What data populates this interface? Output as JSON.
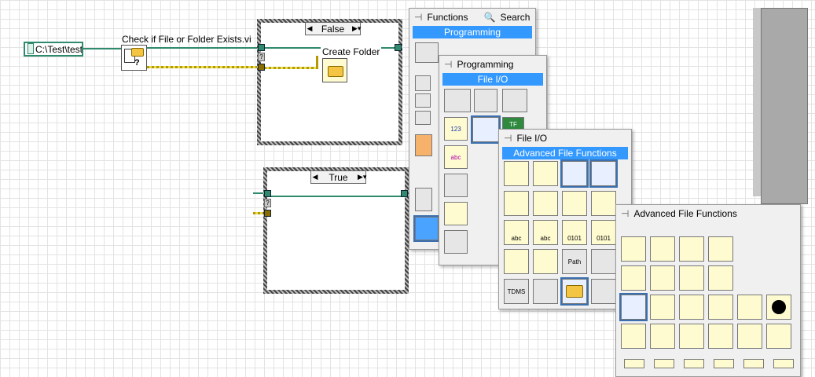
{
  "block_diagram": {
    "path_constant": "C:\\Test\\test",
    "check_vi_label": "Check if File or Folder Exists.vi",
    "case_false": {
      "selector": "False",
      "inner_label": "Create Folder"
    },
    "case_true": {
      "selector": "True"
    }
  },
  "palettes": {
    "functions": {
      "title": "Functions",
      "search_label": "Search",
      "bar": "Programming"
    },
    "programming": {
      "title": "Programming",
      "bar": "File I/O"
    },
    "file_io": {
      "title": "File I/O",
      "bar": "Advanced File Functions"
    },
    "advanced": {
      "title": "Advanced File Functions"
    }
  },
  "icon_text": {
    "q_mark": "?",
    "num123": "123",
    "abc": "abc",
    "tf": "TF",
    "tdms": "TDMS",
    "path": "Path",
    "abc_small": "abc",
    "bin": "0101"
  },
  "colors": {
    "wire_path": "#2f8a6e",
    "wire_bool": "#c7b200",
    "palette_bar": "#3399ff"
  }
}
